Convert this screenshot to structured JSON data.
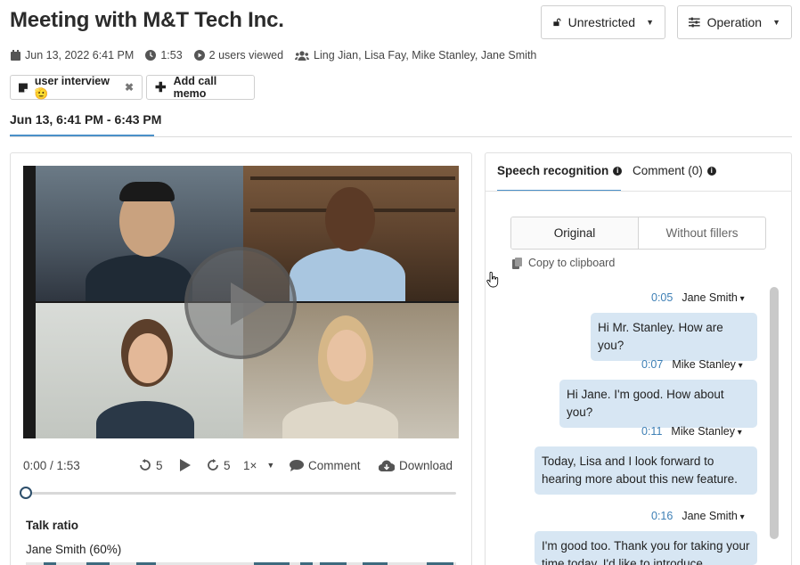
{
  "header": {
    "title": "Meeting with M&T Tech Inc.",
    "visibility_label": "Unrestricted",
    "operation_label": "Operation"
  },
  "meta": {
    "date": "Jun 13, 2022 6:41 PM",
    "duration": "1:53",
    "views": "2 users viewed",
    "participants": "Ling Jian, Lisa Fay, Mike Stanley, Jane Smith"
  },
  "tags": {
    "interview": "user interview 🫡",
    "add_memo": "Add call memo"
  },
  "range": "Jun 13, 6:41 PM - 6:43 PM",
  "player": {
    "time": "0:00 / 1:53",
    "rewind": "5",
    "forward": "5",
    "speed": "1×",
    "comment": "Comment",
    "download": "Download",
    "progress": 0
  },
  "talk": {
    "title": "Talk ratio",
    "person": "Jane Smith (60%)"
  },
  "right": {
    "tab_speech": "Speech recognition",
    "tab_comment": "Comment (0)",
    "opt_original": "Original",
    "opt_without": "Without fillers",
    "copy": "Copy to clipboard"
  },
  "transcript": [
    {
      "time": "0:05",
      "speaker": "Jane Smith",
      "text": "Hi Mr. Stanley. How are you?"
    },
    {
      "time": "0:07",
      "speaker": "Mike Stanley",
      "text": "Hi Jane. I'm good. How about you?"
    },
    {
      "time": "0:11",
      "speaker": "Mike Stanley",
      "text": "Today, Lisa and I look forward to hearing more about this new feature."
    },
    {
      "time": "0:16",
      "speaker": "Jane Smith",
      "text": "I'm good too. Thank you for taking your time today. I'd like to introduce"
    }
  ],
  "colors": {
    "accent": "#4a90c8",
    "bubble": "#d7e6f3",
    "timestamp": "#3d7fb5"
  }
}
